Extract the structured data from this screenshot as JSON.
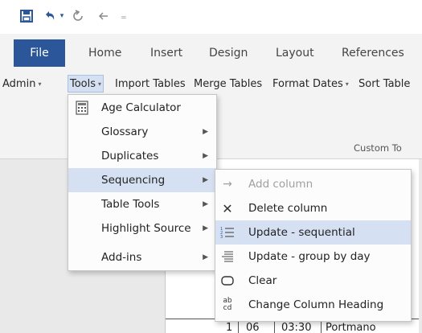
{
  "quick_access": {
    "save_icon": "save-icon",
    "undo_icon": "undo-icon",
    "redo_icon": "redo-icon",
    "back_icon": "back-arrow-icon",
    "customize_icon": "customize-qat-icon",
    "undo_dropdown_glyph": "▾",
    "customize_glyph": "₌"
  },
  "ribbon_tabs": [
    "File",
    "Home",
    "Insert",
    "Design",
    "Layout",
    "References"
  ],
  "toolbar": {
    "items": [
      {
        "label": "Admin",
        "caret": "▾"
      },
      {
        "label": "Tools",
        "caret": "▾"
      },
      {
        "label": "Import Tables",
        "caret": ""
      },
      {
        "label": "Merge Tables",
        "caret": ""
      },
      {
        "label": "Format Dates",
        "caret": "▾"
      },
      {
        "label": "Sort Table",
        "caret": ""
      }
    ],
    "group_label": "Custom To"
  },
  "tools_menu": {
    "items": [
      {
        "label": "Age Calculator",
        "icon": "calculator-icon",
        "submenu": false
      },
      {
        "label": "Glossary",
        "icon": "",
        "submenu": true
      },
      {
        "label": "Duplicates",
        "icon": "",
        "submenu": true
      },
      {
        "label": "Sequencing",
        "icon": "",
        "submenu": true,
        "highlighted": true
      },
      {
        "label": "Table Tools",
        "icon": "",
        "submenu": true
      },
      {
        "label": "Highlight Source",
        "icon": "",
        "submenu": true
      },
      {
        "label": "Add-ins",
        "icon": "",
        "submenu": true
      }
    ],
    "submenu_arrow": "▶"
  },
  "sequencing_menu": {
    "items": [
      {
        "label": "Add column",
        "icon": "right-arrow-icon",
        "disabled": true
      },
      {
        "label": "Delete column",
        "icon": "delete-x-icon"
      },
      {
        "label": "Update - sequential",
        "icon": "numbered-list-icon",
        "highlighted": true
      },
      {
        "label": "Update - group by day",
        "icon": "lines-icon"
      },
      {
        "label": "Clear",
        "icon": "rounded-rect-icon"
      },
      {
        "label": "Change Column Heading",
        "icon": "ab-cd-icon"
      }
    ],
    "glyphs": {
      "arrow": "→",
      "x": "✕",
      "ab": "ab",
      "cd": "cd"
    }
  },
  "document_row": {
    "cells": [
      "1",
      "06",
      "03:30",
      "Portmano"
    ]
  },
  "colors": {
    "accent": "#2b579a",
    "highlight": "#d5e1f2",
    "ribbon_bg": "#f3f3f3"
  }
}
